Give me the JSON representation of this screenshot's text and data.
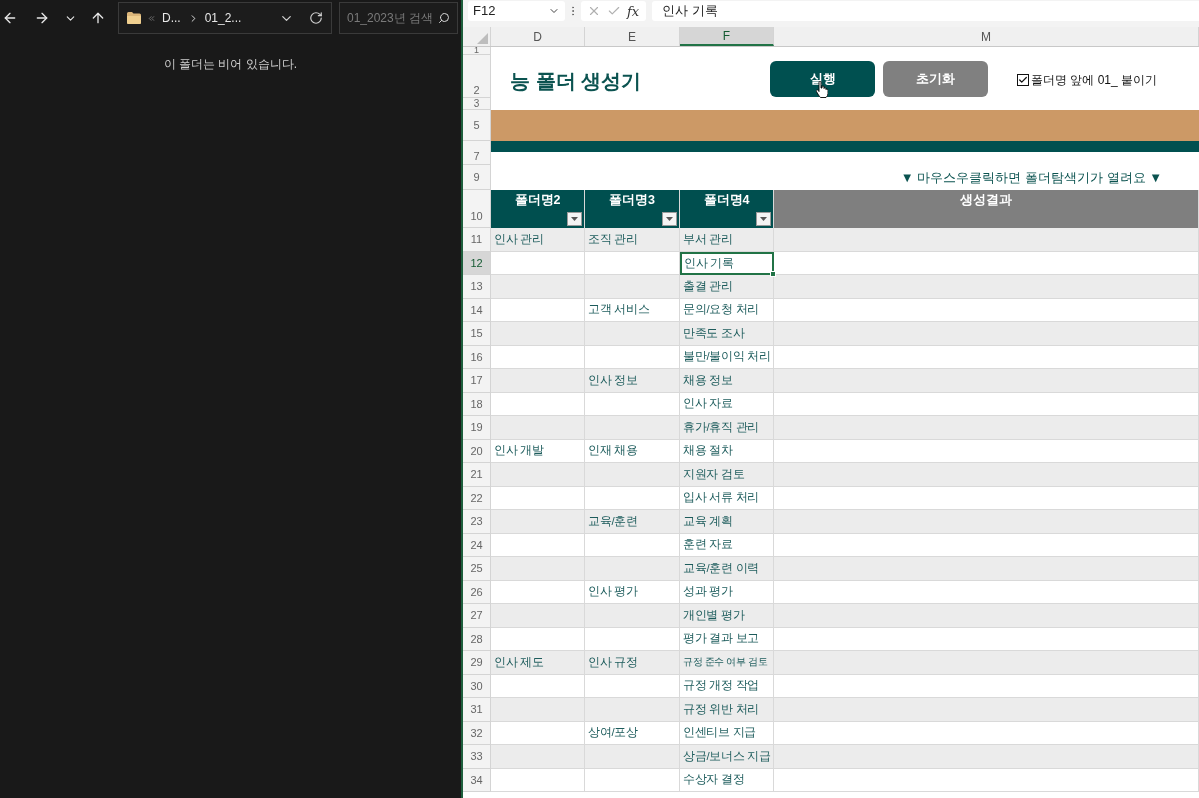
{
  "explorer": {
    "address_bar": {
      "crumbs": [
        "D...",
        "01_2..."
      ]
    },
    "search": {
      "placeholder": "01_2023년 검색"
    },
    "empty_message": "이 폴더는 비어 있습니다."
  },
  "excel": {
    "name_box": "F12",
    "insert_function": "fx",
    "formula": "인사 기록",
    "columns": [
      {
        "label": "D",
        "selected": false
      },
      {
        "label": "E",
        "selected": false
      },
      {
        "label": "F",
        "selected": true
      },
      {
        "label": "M",
        "selected": false
      }
    ],
    "top_rows": [
      {
        "number": "1",
        "kind": "margin_top"
      },
      {
        "number": "2",
        "kind": "title"
      },
      {
        "number": "3",
        "kind": "margin_bottom"
      },
      {
        "number": "5",
        "kind": "accent_band"
      },
      {
        "number": "7",
        "kind": "stripe_band"
      },
      {
        "number": "9",
        "kind": "hint"
      }
    ],
    "title": "능 폴더 생성기",
    "buttons": [
      {
        "label": "실행",
        "kind": "primary"
      },
      {
        "label": "초기화",
        "kind": "secondary"
      }
    ],
    "option": {
      "label": "폴더명 앞에 01_ 붙이기",
      "checked": true
    },
    "hint": "▼ 마우스우클릭하면 폴더탐색기가 열려요 ▼",
    "table": {
      "header": {
        "number": "10",
        "cells": [
          {
            "label": "폴더명2",
            "filter": true,
            "kind": "folder"
          },
          {
            "label": "폴더명3",
            "filter": true,
            "kind": "folder"
          },
          {
            "label": "폴더명4",
            "filter": true,
            "kind": "folder"
          },
          {
            "label": "생성결과",
            "filter": false,
            "kind": "result"
          }
        ]
      },
      "rows": [
        {
          "number": "11",
          "d": "인사 관리",
          "e": "조직 관리",
          "f": "부서 관리",
          "selected": false,
          "f_shrunk": false
        },
        {
          "number": "12",
          "f": "인사 기록",
          "selected": true,
          "f_shrunk": false
        },
        {
          "number": "13",
          "f": "출결 관리",
          "selected": false,
          "f_shrunk": false
        },
        {
          "number": "14",
          "e": "고객 서비스",
          "f": "문의/요청 처리",
          "selected": false,
          "f_shrunk": false
        },
        {
          "number": "15",
          "f": "만족도 조사",
          "selected": false,
          "f_shrunk": false
        },
        {
          "number": "16",
          "f": "불만/불이익 처리",
          "selected": false,
          "f_shrunk": false
        },
        {
          "number": "17",
          "e": "인사 정보",
          "f": "채용 정보",
          "selected": false,
          "f_shrunk": false
        },
        {
          "number": "18",
          "f": "인사 자료",
          "selected": false,
          "f_shrunk": false
        },
        {
          "number": "19",
          "f": "휴가/휴직 관리",
          "selected": false,
          "f_shrunk": false
        },
        {
          "number": "20",
          "d": "인사 개발",
          "e": "인재 채용",
          "f": "채용 절차",
          "selected": false,
          "f_shrunk": false
        },
        {
          "number": "21",
          "f": "지원자 검토",
          "selected": false,
          "f_shrunk": false
        },
        {
          "number": "22",
          "f": "입사 서류 처리",
          "selected": false,
          "f_shrunk": false
        },
        {
          "number": "23",
          "e": "교육/훈련",
          "f": "교육 계획",
          "selected": false,
          "f_shrunk": false
        },
        {
          "number": "24",
          "f": "훈련 자료",
          "selected": false,
          "f_shrunk": false
        },
        {
          "number": "25",
          "f": "교육/훈련 이력",
          "selected": false,
          "f_shrunk": false
        },
        {
          "number": "26",
          "e": "인사 평가",
          "f": "성과 평가",
          "selected": false,
          "f_shrunk": false
        },
        {
          "number": "27",
          "f": "개인별 평가",
          "selected": false,
          "f_shrunk": false
        },
        {
          "number": "28",
          "f": "평가 결과 보고",
          "selected": false,
          "f_shrunk": false
        },
        {
          "number": "29",
          "d": "인사 제도",
          "e": "인사 규정",
          "f": "규정 준수 여부 검토",
          "selected": false,
          "f_shrunk": true
        },
        {
          "number": "30",
          "f": "규정 개정 작업",
          "selected": false,
          "f_shrunk": false
        },
        {
          "number": "31",
          "f": "규정 위반 처리",
          "selected": false,
          "f_shrunk": false
        },
        {
          "number": "32",
          "e": "상여/포상",
          "f": "인센티브 지급",
          "selected": false,
          "f_shrunk": false
        },
        {
          "number": "33",
          "f": "상금/보너스 지급",
          "selected": false,
          "f_shrunk": false
        },
        {
          "number": "34",
          "f": "수상자 결정",
          "selected": false,
          "f_shrunk": false
        }
      ]
    }
  }
}
